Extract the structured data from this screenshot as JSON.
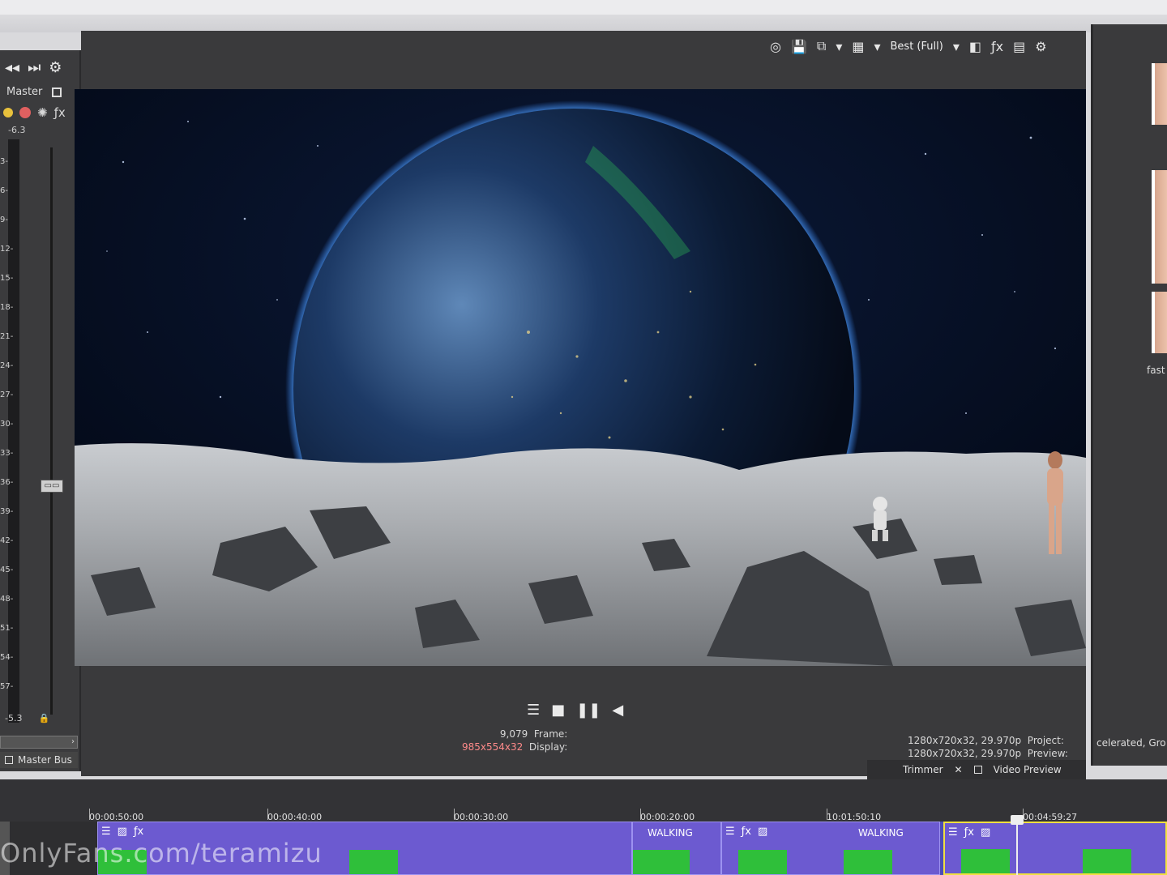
{
  "mixer": {
    "label": "Master",
    "peak": "-6.3",
    "scale": [
      "3",
      "6",
      "9",
      "12",
      "15",
      "18",
      "21",
      "24",
      "27",
      "30",
      "33",
      "36",
      "39",
      "42",
      "45",
      "48",
      "51",
      "54",
      "57"
    ],
    "footer_left": "-5.3",
    "tab_label": "Master Bus"
  },
  "preview": {
    "quality": "Best (Full)",
    "frame_label": "Frame:",
    "frame_value": "9,079",
    "display_label": "Display:",
    "display_value": "985x554x32",
    "project_label": "Project:",
    "project_value": "1280x720x32, 29.970p",
    "preview_label": "Preview:",
    "preview_value": "1280x720x32, 29.970p",
    "tab_video_preview": "Video Preview",
    "tab_trimmer": "Trimmer"
  },
  "right_panel": {
    "caption_1": "fast",
    "caption_2": "celerated, Gro"
  },
  "timeline": {
    "ruler_labels": [
      "00:00:50:00",
      "00:00:40:00",
      "00:00:30:00",
      "00:00:20:00",
      "10:01:50:10",
      "00:04:59:27"
    ],
    "clip_titles": [
      "WALKING",
      "WALKING"
    ],
    "watermark": "OnlyFans.com/teramizu"
  },
  "colors": {
    "panel_bg": "#3a3a3c",
    "track_bg": "#4c4cb8",
    "clip_bg": "#6c5ad0",
    "greenscreen": "#2fbf3a",
    "display_value_red": "#ff8a8a"
  }
}
